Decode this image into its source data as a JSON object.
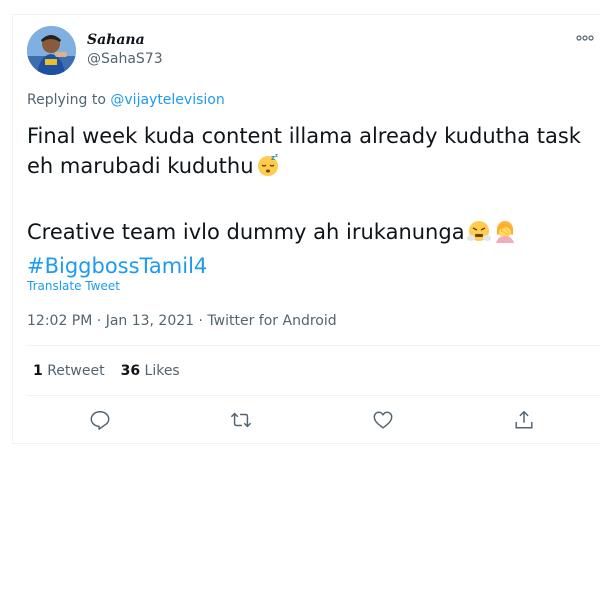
{
  "user": {
    "display_name": "Sahana",
    "handle": "@SahaS73"
  },
  "reply": {
    "prefix": "Replying to",
    "mention": "@vijaytelevision"
  },
  "tweet": {
    "line1": "Final week kuda content illama already kudutha task eh marubadi kuduthu",
    "line2": "Creative team ivlo dummy ah irukanunga",
    "hashtag": "#BiggbossTamil4",
    "translate_label": "Translate Tweet"
  },
  "meta": {
    "time": "12:02 PM",
    "date": "Jan 13, 2021",
    "source": "Twitter for Android",
    "separator": "·"
  },
  "stats": {
    "retweets_count": "1",
    "retweets_label": "Retweet",
    "likes_count": "36",
    "likes_label": "Likes"
  },
  "icons": {
    "more": "more-icon",
    "reply": "reply-icon",
    "retweet": "retweet-icon",
    "like": "like-icon",
    "share": "share-icon",
    "emoji_sleeping": "sleeping-face-emoji",
    "emoji_steam": "face-with-steam-emoji",
    "emoji_facepalm": "woman-facepalming-emoji"
  },
  "colors": {
    "link": "#1d9bf0",
    "muted": "#536471",
    "text": "#0f1419"
  }
}
